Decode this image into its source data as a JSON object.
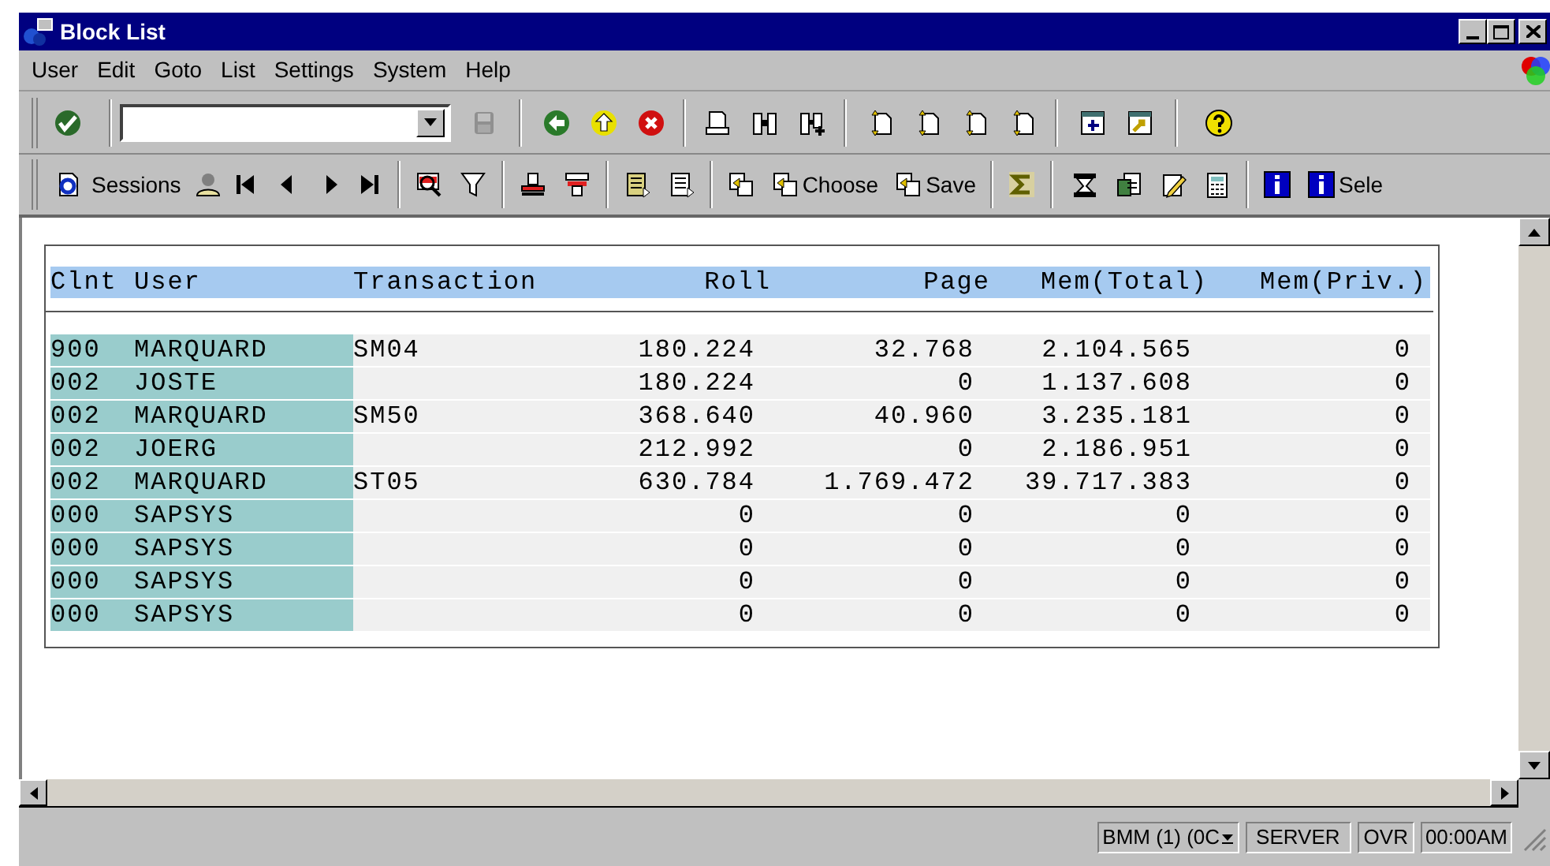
{
  "window": {
    "title": "Block List"
  },
  "menu": [
    {
      "label": "User"
    },
    {
      "label": "Edit"
    },
    {
      "label": "Goto"
    },
    {
      "label": "List"
    },
    {
      "label": "Settings"
    },
    {
      "label": "System"
    },
    {
      "label": "Help"
    }
  ],
  "application_toolbar": [
    {
      "label": "Sessions"
    },
    {
      "label": "Choose"
    },
    {
      "label": "Save"
    },
    {
      "label": "Sele"
    }
  ],
  "table": {
    "columns": [
      "Clnt",
      "User",
      "Transaction",
      "Roll",
      "Page",
      "Mem(Total)",
      "Mem(Priv.)"
    ],
    "rows": [
      [
        "900",
        "MARQUARD",
        "SM04",
        "180.224",
        "32.768",
        "2.104.565",
        "0"
      ],
      [
        "002",
        "JOSTE",
        "",
        "180.224",
        "0",
        "1.137.608",
        "0"
      ],
      [
        "002",
        "MARQUARD",
        "SM50",
        "368.640",
        "40.960",
        "3.235.181",
        "0"
      ],
      [
        "002",
        "JOERG",
        "",
        "212.992",
        "0",
        "2.186.951",
        "0"
      ],
      [
        "002",
        "MARQUARD",
        "ST05",
        "630.784",
        "1.769.472",
        "39.717.383",
        "0"
      ],
      [
        "000",
        "SAPSYS",
        "",
        "0",
        "0",
        "0",
        "0"
      ],
      [
        "000",
        "SAPSYS",
        "",
        "0",
        "0",
        "0",
        "0"
      ],
      [
        "000",
        "SAPSYS",
        "",
        "0",
        "0",
        "0",
        "0"
      ],
      [
        "000",
        "SAPSYS",
        "",
        "0",
        "0",
        "0",
        "0"
      ]
    ]
  },
  "status_bar": {
    "system": "BMM (1) (0C",
    "server": "SERVER",
    "mode": "OVR",
    "time": "00:00AM"
  }
}
